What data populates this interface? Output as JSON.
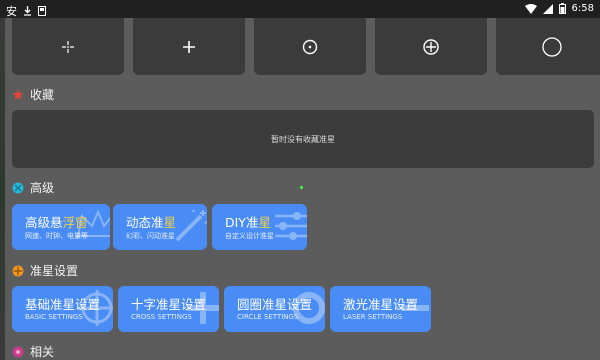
{
  "status": {
    "time": "6:58",
    "app_icon": "chinese-app-icon",
    "download_icon": "download-icon",
    "notif_icon": "notification-icon"
  },
  "top_tiles": [
    {
      "icon": "dot-cross"
    },
    {
      "icon": "plus"
    },
    {
      "icon": "circle-dot"
    },
    {
      "icon": "circle-plus"
    },
    {
      "icon": "circle"
    }
  ],
  "favorites": {
    "title": "收藏",
    "empty": "暂时没有收藏准星",
    "icon_color": "#e0463c"
  },
  "advanced": {
    "title": "高级",
    "icon_color": "#21b8d8",
    "cards": [
      {
        "title_a": "高级悬",
        "title_b": "浮窗",
        "sub": "网速、时钟、电量等"
      },
      {
        "title_a": "动态准",
        "title_b": "星",
        "sub": "幻彩、闪动准星"
      },
      {
        "title_a": "DIY准",
        "title_b": "星",
        "sub": "自定义设计准星"
      }
    ]
  },
  "crosshair": {
    "title": "准星设置",
    "icon_color": "#f29a1e",
    "cards": [
      {
        "title": "基础准星设置",
        "sub": "BASIC SETTINGS"
      },
      {
        "title": "十字准星设置",
        "sub": "CROSS SETTINGS"
      },
      {
        "title": "圆圈准星设置",
        "sub": "CIRCLE SETTINGS"
      },
      {
        "title": "激光准星设置",
        "sub": "LASER SETTINGS"
      }
    ]
  },
  "related": {
    "title": "相关",
    "icon_color": "#c83c8c"
  },
  "colors": {
    "accent": "#4a8cf5",
    "highlight": "#f5d040"
  }
}
